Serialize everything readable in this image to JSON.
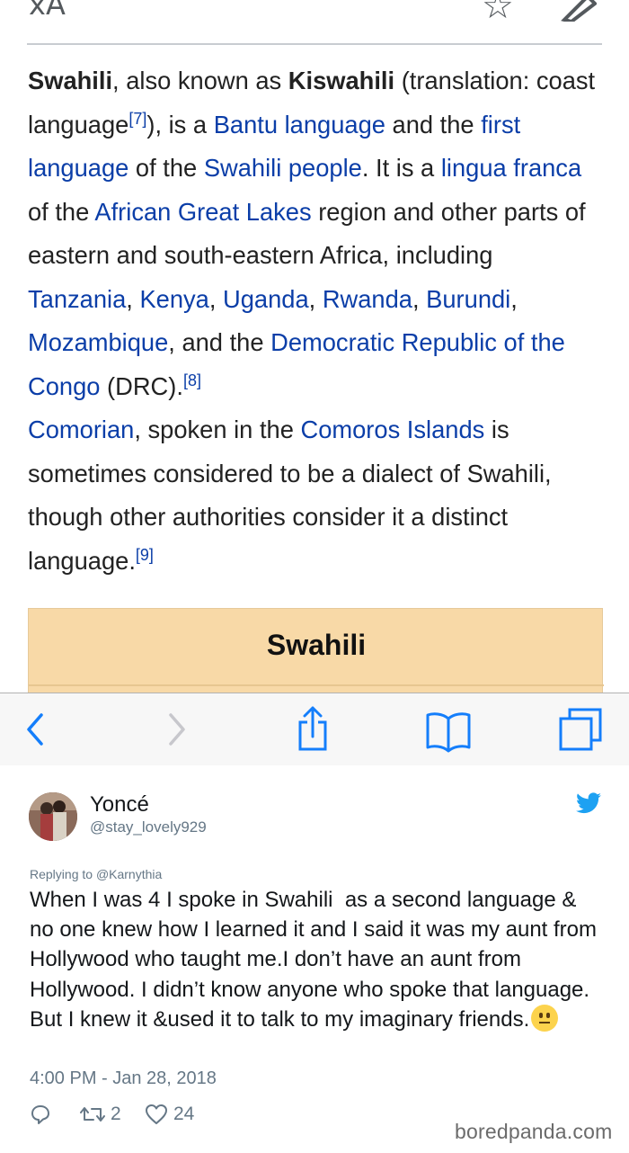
{
  "wiki": {
    "toolbar_icons": [
      "translate-icon",
      "star-icon",
      "edit-pencil-icon"
    ],
    "lang_glyph": "ẋA",
    "star_glyph": "☆",
    "paragraph": {
      "w1": "Swahili",
      "t1": ", also known as ",
      "w2": "Kiswahili",
      "t2": " (translation: coast language",
      "ref7": "[7]",
      "t3": "), is a ",
      "l_bantu": "Bantu language",
      "t4": " and the ",
      "l_first": "first language",
      "t5": " of the ",
      "l_swpeople": "Swahili people",
      "t6": ". It is a ",
      "l_lingua": "lingua franca",
      "t7": " of the ",
      "l_agl": "African Great Lakes",
      "t8": " region and other parts of eastern and south-eastern Africa, including ",
      "l_tz": "Tanzania",
      "c1": ", ",
      "l_ke": "Kenya",
      "c2": ", ",
      "l_ug": "Uganda",
      "c3": ", ",
      "l_rw": "Rwanda",
      "c4": ", ",
      "l_bu": "Burundi",
      "c5": ", ",
      "l_mz": "Mozambique",
      "t9": ", and the ",
      "l_drc": "Democratic Republic of the Congo",
      "t10": " (DRC).",
      "ref8": "[8]",
      "l_comorian": "Comorian",
      "t11": ", spoken in the ",
      "l_comoros": "Comoros Islands",
      "t12": " is sometimes considered to be a dialect of Swahili, though other authorities consider it a distinct language.",
      "ref9": "[9]"
    },
    "infobox_title": "Swahili"
  },
  "safari_toolbar": {
    "icons": [
      "back-chevron-icon",
      "forward-chevron-icon",
      "share-icon",
      "bookmarks-icon",
      "tabs-icon"
    ]
  },
  "tweet": {
    "display_name": "Yoncé",
    "handle": "@stay_lovely929",
    "replying_prefix": "Replying to ",
    "replying_to": "@Karnythia",
    "text": "When I was 4 I spoke in Swahili  as a second language & no one knew how I learned it and I said it was my aunt from Hollywood who taught me.I don’t have an aunt from Hollywood. I didn’t know anyone who spoke that language. But I knew it &used it to talk to my imaginary friends.",
    "emoji": "neutral-face-emoji",
    "timestamp": "4:00 PM - Jan 28, 2018",
    "retweets": "2",
    "likes": "24"
  },
  "colors": {
    "link": "#0b3ea8",
    "infobox_bg": "#f8d9a7",
    "ios_blue": "#147efb",
    "twitter_blue": "#1da1f2",
    "muted": "#657786"
  },
  "watermark": "boredpanda.com"
}
